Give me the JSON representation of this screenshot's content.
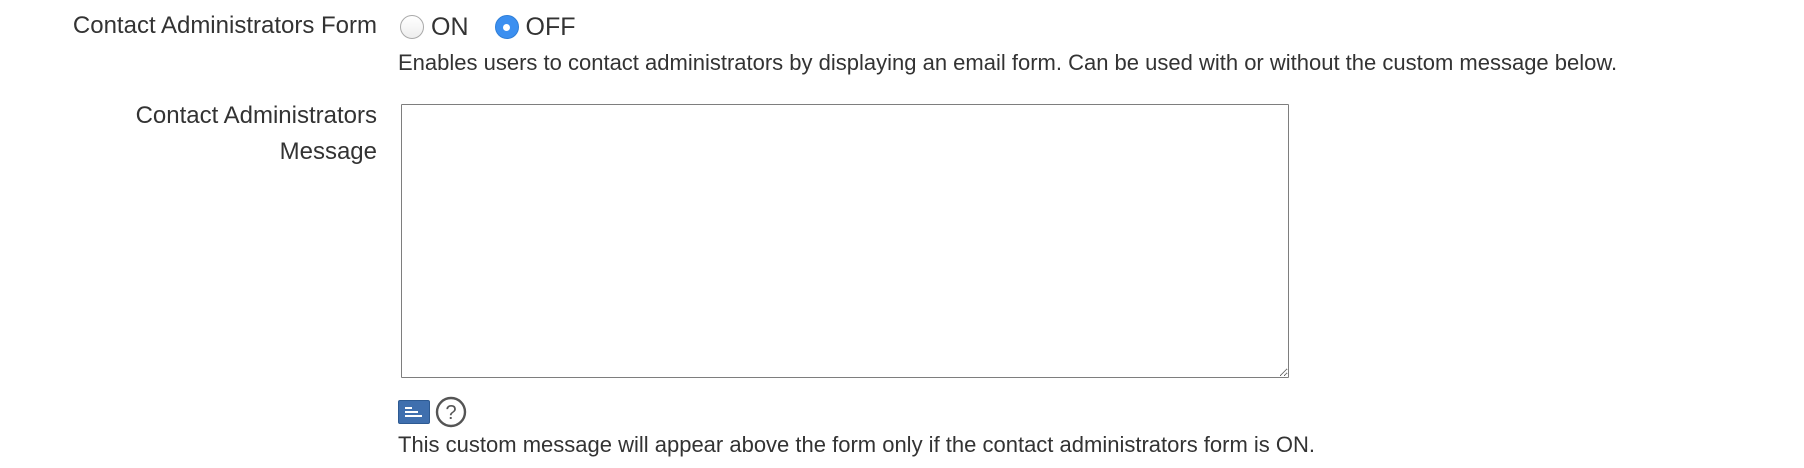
{
  "contact_form": {
    "label": "Contact Administrators Form",
    "options": [
      {
        "label": "ON",
        "checked": false
      },
      {
        "label": "OFF",
        "checked": true
      }
    ],
    "help": "Enables users to contact administrators by displaying an email form. Can be used with or without the custom message below."
  },
  "contact_message": {
    "label_line1": "Contact Administrators",
    "label_line2": "Message",
    "value": "",
    "icons": {
      "editor": "rich-text-editor-icon",
      "help": "question-mark-icon"
    },
    "help": "This custom message will appear above the form only if the contact administrators form is ON."
  },
  "colors": {
    "radio_selected": "#3b8ff0",
    "editor_icon": "#3f6fae",
    "text": "#333333"
  }
}
